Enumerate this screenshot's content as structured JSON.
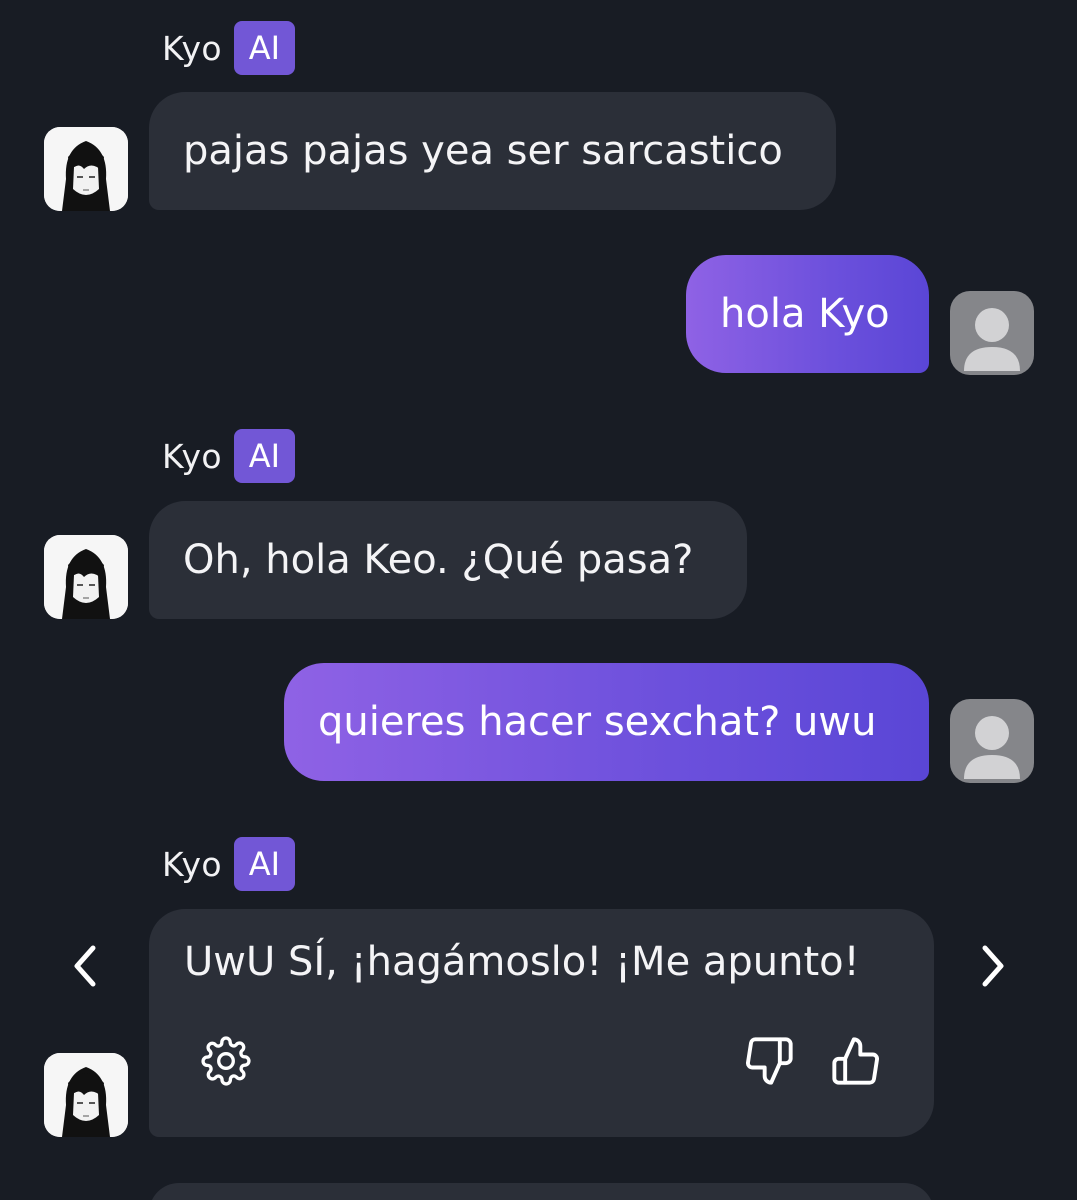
{
  "colors": {
    "background": "#181c24",
    "bot_bubble": "#2b2f38",
    "user_bubble_start": "#8f62e5",
    "user_bubble_end": "#5a46d6",
    "ai_badge": "#7257d6",
    "user_avatar_bg": "#85868a"
  },
  "messages": [
    {
      "role": "bot",
      "sender": "Kyo",
      "badge": "AI",
      "text": "pajas pajas yea ser sarcastico"
    },
    {
      "role": "user",
      "text": "hola Kyo"
    },
    {
      "role": "bot",
      "sender": "Kyo",
      "badge": "AI",
      "text": "Oh, hola Keo. ¿Qué pasa?"
    },
    {
      "role": "user",
      "text": "quieres hacer sexchat? uwu"
    },
    {
      "role": "bot",
      "sender": "Kyo",
      "badge": "AI",
      "text": "UwU SÍ, ¡hagámoslo! ¡Me apunto!"
    }
  ],
  "icons": {
    "prev": "chevron-left-icon",
    "next": "chevron-right-icon",
    "settings": "gear-icon",
    "dislike": "thumbs-down-icon",
    "like": "thumbs-up-icon",
    "user_avatar": "person-icon"
  }
}
